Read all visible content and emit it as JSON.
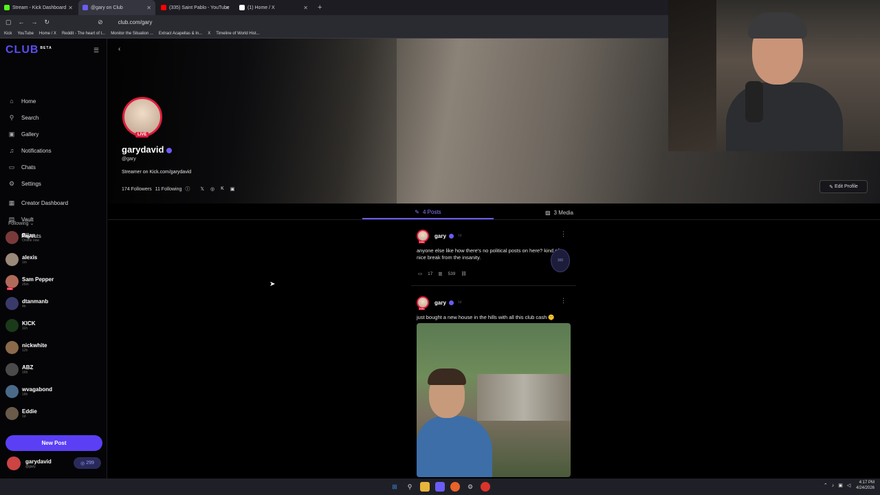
{
  "browser": {
    "tabs": [
      {
        "title": "Stream - Kick Dashboard",
        "color": "#53fc18"
      },
      {
        "title": "@gary on Club",
        "color": "#6b5cf6"
      },
      {
        "title": "(335) Saint Pablo - YouTube",
        "color": "#ff0000"
      },
      {
        "title": "(1) Home / X",
        "color": "#ffffff"
      }
    ],
    "url": "club.com/gary",
    "bookmarks": [
      "Kick",
      "YouTube",
      "Home / X",
      "Reddit - The heart of t...",
      "Monitor the Situation ...",
      "Extract Acapellas & In...",
      "X",
      "Timeline of World Hist..."
    ]
  },
  "sidebar": {
    "logo": "CLUB",
    "logo_badge": "BETA",
    "nav": [
      {
        "label": "Home",
        "icon": "home-icon",
        "glyph": "⌂"
      },
      {
        "label": "Search",
        "icon": "search-icon",
        "glyph": "⚲"
      },
      {
        "label": "Gallery",
        "icon": "gallery-icon",
        "glyph": "▣"
      },
      {
        "label": "Notifications",
        "icon": "bell-icon",
        "glyph": "♫"
      },
      {
        "label": "Chats",
        "icon": "chat-icon",
        "glyph": "▭"
      },
      {
        "label": "Settings",
        "icon": "gear-icon",
        "glyph": "⚙"
      },
      {
        "label": "Creator Dashboard",
        "icon": "dashboard-icon",
        "glyph": "▦"
      },
      {
        "label": "Vault",
        "icon": "vault-icon",
        "glyph": "▤"
      },
      {
        "label": "Payouts",
        "icon": "payouts-icon",
        "glyph": "◎"
      }
    ],
    "following_label": "Following",
    "following": [
      {
        "name": "Bijan",
        "sub": "Online now",
        "live": false,
        "color": "#7a3a3a"
      },
      {
        "name": "alexis",
        "sub": "1m",
        "live": false,
        "color": "#9a8a7a"
      },
      {
        "name": "Sam Pepper",
        "sub": "26m",
        "live": true,
        "color": "#b06a5a"
      },
      {
        "name": "dtanmanb",
        "sub": "4h",
        "live": false,
        "color": "#3a3a6a"
      },
      {
        "name": "KICK",
        "sub": "11h",
        "live": false,
        "color": "#1a3a1a"
      },
      {
        "name": "nickwhite",
        "sub": "12h",
        "live": false,
        "color": "#8a6a4a"
      },
      {
        "name": "ABZ",
        "sub": "16h",
        "live": false,
        "color": "#4a4a4a"
      },
      {
        "name": "wvagabond",
        "sub": "18h",
        "live": false,
        "color": "#4a6a8a"
      },
      {
        "name": "Eddie",
        "sub": "1d",
        "live": false,
        "color": "#6a5a4a"
      }
    ],
    "new_post": "New Post",
    "me": {
      "name": "garydavid",
      "handle": "@gary",
      "cash": "299"
    }
  },
  "profile": {
    "name": "garydavid",
    "handle": "@gary",
    "live": "LIVE",
    "bio": "Streamer on Kick.com/garydavid",
    "followers": "174 Followers",
    "following": "11 Following",
    "edit": "Edit Profile"
  },
  "tabs": {
    "posts": "4 Posts",
    "media": "3 Media"
  },
  "posts": [
    {
      "author": "gary",
      "time": "1d",
      "text": "anyone else like how there's no political posts on here? kind of a nice break from the insanity.",
      "comments": "17",
      "views": "539",
      "token": "300"
    },
    {
      "author": "gary",
      "time": "1d",
      "text": "just bought a new house in the hills with all this club cash 🤫"
    }
  ],
  "taskbar": {
    "time": "4:17 PM",
    "date": "4/24/2026"
  }
}
